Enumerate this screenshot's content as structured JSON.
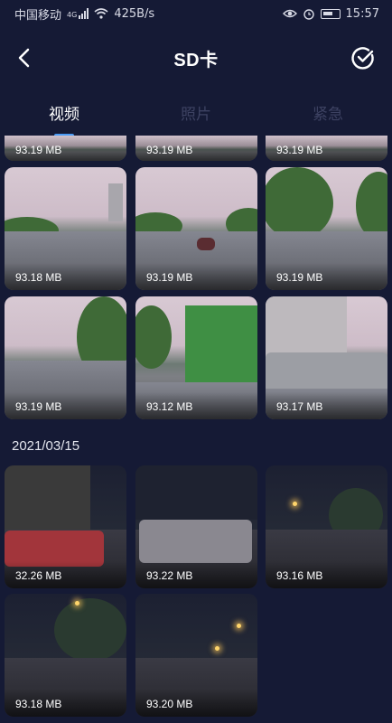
{
  "status_bar": {
    "carrier": "中国移动",
    "network": "4G",
    "speed": "425B/s",
    "time": "15:57"
  },
  "header": {
    "title": "SD卡",
    "back_icon": "chevron-left-icon",
    "confirm_icon": "check-circle-icon"
  },
  "tabs": [
    {
      "label": "视频",
      "active": true
    },
    {
      "label": "照片",
      "active": false
    },
    {
      "label": "紧急",
      "active": false
    }
  ],
  "partial_row": [
    "93.19 MB",
    "93.19 MB",
    "93.19 MB"
  ],
  "group1": {
    "items": [
      {
        "size": "93.18 MB"
      },
      {
        "size": "93.19 MB"
      },
      {
        "size": "93.19 MB"
      },
      {
        "size": "93.19 MB"
      },
      {
        "size": "93.12 MB"
      },
      {
        "size": "93.17 MB"
      }
    ]
  },
  "group2": {
    "date": "2021/03/15",
    "items": [
      {
        "size": "32.26 MB"
      },
      {
        "size": "93.22 MB"
      },
      {
        "size": "93.16 MB"
      },
      {
        "size": "93.18 MB"
      },
      {
        "size": "93.20 MB"
      }
    ]
  },
  "colors": {
    "background": "#151a35",
    "accent": "#4a9bf5",
    "inactive_tab": "#3d4262"
  }
}
